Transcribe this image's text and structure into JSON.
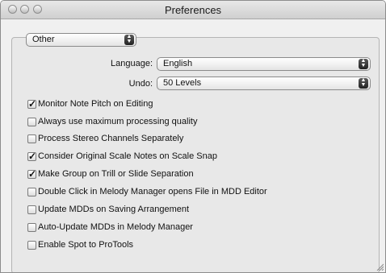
{
  "window": {
    "title": "Preferences"
  },
  "category_popup": {
    "selected": "Other"
  },
  "language": {
    "label": "Language:",
    "selected": "English"
  },
  "undo": {
    "label": "Undo:",
    "selected": "50 Levels"
  },
  "options": [
    {
      "label": "Monitor Note Pitch on Editing",
      "checked": true
    },
    {
      "label": "Always use maximum processing quality",
      "checked": false
    },
    {
      "label": "Process Stereo Channels Separately",
      "checked": false
    },
    {
      "label": "Consider Original Scale Notes on Scale Snap",
      "checked": true
    },
    {
      "label": "Make Group on Trill or Slide Separation",
      "checked": true
    },
    {
      "label": "Double Click in Melody Manager opens File in MDD Editor",
      "checked": false
    },
    {
      "label": "Update MDDs on Saving Arrangement",
      "checked": false
    },
    {
      "label": "Auto-Update MDDs in Melody Manager",
      "checked": false
    },
    {
      "label": "Enable Spot to ProTools",
      "checked": false
    }
  ],
  "icons": {
    "check": "checkmark-icon",
    "popup_arrows": "updown-arrows-icon",
    "resize": "resize-grip-icon"
  }
}
